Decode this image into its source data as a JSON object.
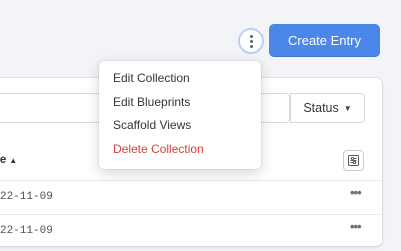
{
  "header": {
    "more_actions_icon": "kebab-vertical-icon",
    "create_label": "Create Entry",
    "accent_color": "#4a87e9"
  },
  "filters": {
    "search_value": "",
    "status_label": "Status",
    "status_icon": "chevron-down-icon"
  },
  "table": {
    "columns": [
      {
        "label": "te",
        "sort": "ascending",
        "sort_icon": "caret-up-icon"
      }
    ],
    "column_settings_icon": "sliders-icon",
    "rows": [
      {
        "date": "22-11-09",
        "actions_icon": "ellipsis-icon"
      },
      {
        "date": "22-11-09",
        "actions_icon": "ellipsis-icon"
      }
    ]
  },
  "dropdown": {
    "items": [
      {
        "label": "Edit Collection",
        "style": "normal"
      },
      {
        "label": "Edit Blueprints",
        "style": "normal"
      },
      {
        "label": "Scaffold Views",
        "style": "normal"
      },
      {
        "label": "Delete Collection",
        "style": "danger",
        "color": "#d0443d"
      }
    ]
  }
}
